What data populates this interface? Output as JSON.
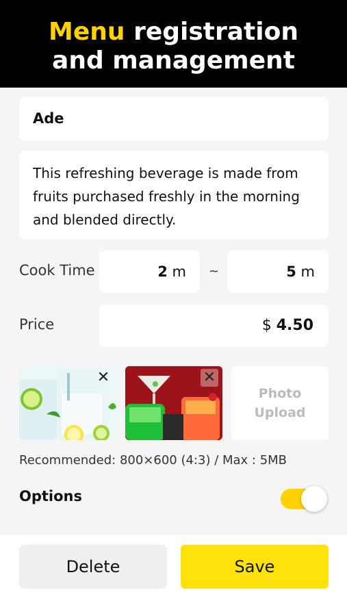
{
  "header": {
    "title_accent": "Menu",
    "title_rest": " registration",
    "title_line2": "and management"
  },
  "menu": {
    "name": "Ade",
    "description": "This refreshing beverage is made from fruits purchased freshly in the morning and blended directly."
  },
  "cook_time": {
    "label": "Cook Time",
    "min_value": "2",
    "max_value": "5",
    "unit": "m",
    "separator": "~"
  },
  "price": {
    "label": "Price",
    "currency": "$",
    "value": "4.50"
  },
  "photos": {
    "items": [
      {
        "name": "lemon-lime drink photo",
        "close_label": "✕"
      },
      {
        "name": "cocktails photo",
        "close_label": "✕"
      }
    ],
    "upload_line1": "Photo",
    "upload_line2": "Upload",
    "recommendation": "Recommended: 800×600 (4:3) / Max : 5MB"
  },
  "options": {
    "label": "Options",
    "enabled": true
  },
  "actions": {
    "delete_label": "Delete",
    "save_label": "Save"
  },
  "colors": {
    "accent": "#ffd200",
    "save_button": "#ffe20a",
    "header_bg": "#000000"
  }
}
